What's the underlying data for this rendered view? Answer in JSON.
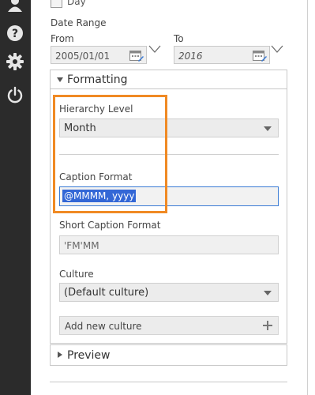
{
  "sidebar": {
    "icons": [
      "user-icon",
      "help-icon",
      "gear-icon",
      "power-icon"
    ]
  },
  "filters": {
    "day_label": "Day",
    "date_range_label": "Date Range",
    "from_label": "From",
    "from_value": "2005/01/01",
    "to_label": "To",
    "to_value": "2016"
  },
  "formatting": {
    "title": "Formatting",
    "hierarchy_level_label": "Hierarchy Level",
    "hierarchy_level_value": "Month",
    "caption_format_label": "Caption Format",
    "caption_format_value": "@MMMM, yyyy",
    "short_caption_format_label": "Short Caption Format",
    "short_caption_format_value": "'FM'MM",
    "culture_label": "Culture",
    "culture_value": "(Default culture)",
    "add_culture_label": "Add new culture"
  },
  "preview": {
    "title": "Preview"
  },
  "colors": {
    "sidebar_bg": "#2b2b2b",
    "highlight": "#f08a24",
    "selection": "#3367d6",
    "focus_border": "#3a7bd5"
  }
}
